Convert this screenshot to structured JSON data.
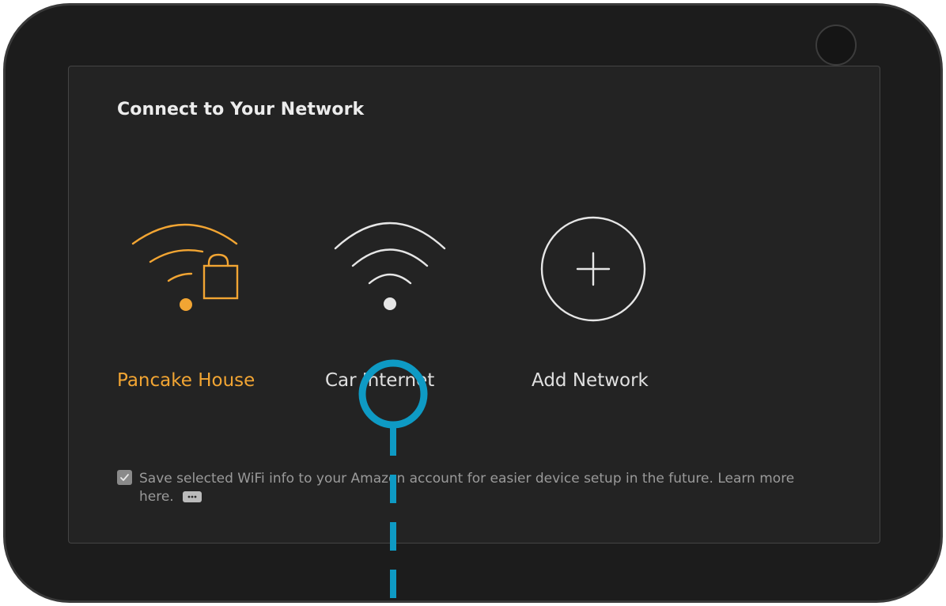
{
  "screen": {
    "title": "Connect to Your Network"
  },
  "networks": [
    {
      "name": "Pancake House",
      "icon": "wifi-locked-icon",
      "selected": true
    },
    {
      "name": "Car Internet",
      "icon": "wifi-icon",
      "selected": false
    },
    {
      "name": "Add Network",
      "icon": "plus-circle-icon",
      "selected": false
    }
  ],
  "save_option": {
    "checked": true,
    "text": "Save selected WiFi info to your Amazon account for easier device setup in the future. Learn more",
    "text_end": "here."
  },
  "colors": {
    "accent": "#f2a533",
    "tap_indicator": "#0e9ac4"
  }
}
